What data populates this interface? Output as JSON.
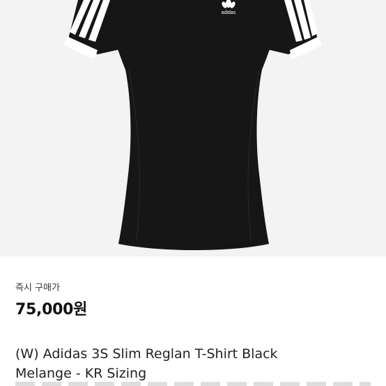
{
  "product": {
    "image_label": "adidas",
    "buy_type_label": "즉시 구매가",
    "price": "75,000원",
    "title_line1": "(W) Adidas 3S Slim Reglan T-Shirt Black",
    "title_line2": "Melange - KR Sizing"
  },
  "colors": {
    "image_background": "#f3f3f3",
    "shirt": "#161616",
    "stripes": "#ffffff"
  }
}
